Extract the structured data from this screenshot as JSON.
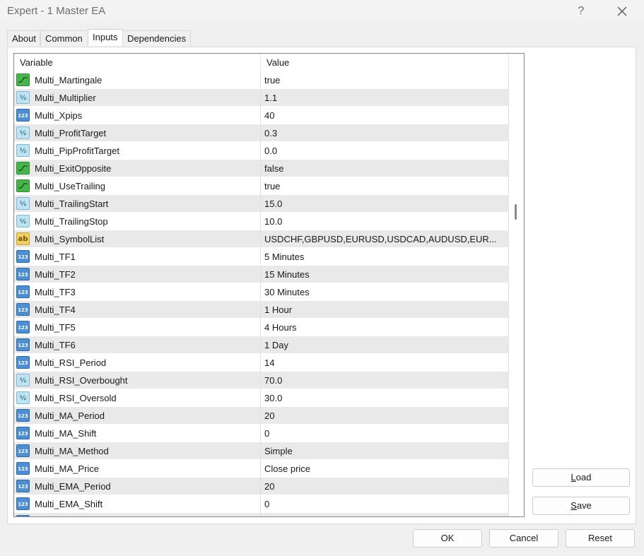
{
  "window": {
    "title": "Expert - 1 Master EA",
    "help_label": "?",
    "close_icon": "close-icon"
  },
  "tabs": [
    {
      "label": "About",
      "active": false
    },
    {
      "label": "Common",
      "active": false
    },
    {
      "label": "Inputs",
      "active": true
    },
    {
      "label": "Dependencies",
      "active": false
    }
  ],
  "grid": {
    "headers": {
      "variable": "Variable",
      "value": "Value"
    },
    "rows": [
      {
        "type": "bool",
        "name": "Multi_Martingale",
        "value": "true"
      },
      {
        "type": "double",
        "name": "Multi_Multiplier",
        "value": "1.1"
      },
      {
        "type": "int",
        "name": "Multi_Xpips",
        "value": "40"
      },
      {
        "type": "double",
        "name": "Multi_ProfitTarget",
        "value": "0.3"
      },
      {
        "type": "double",
        "name": "Multi_PipProfitTarget",
        "value": "0.0"
      },
      {
        "type": "bool",
        "name": "Multi_ExitOpposite",
        "value": "false"
      },
      {
        "type": "bool",
        "name": "Multi_UseTrailing",
        "value": "true"
      },
      {
        "type": "double",
        "name": "Multi_TrailingStart",
        "value": "15.0"
      },
      {
        "type": "double",
        "name": "Multi_TrailingStop",
        "value": "10.0"
      },
      {
        "type": "string",
        "name": "Multi_SymbolList",
        "value": "USDCHF,GBPUSD,EURUSD,USDCAD,AUDUSD,EUR..."
      },
      {
        "type": "int",
        "name": "Multi_TF1",
        "value": "5 Minutes"
      },
      {
        "type": "int",
        "name": "Multi_TF2",
        "value": "15 Minutes"
      },
      {
        "type": "int",
        "name": "Multi_TF3",
        "value": "30 Minutes"
      },
      {
        "type": "int",
        "name": "Multi_TF4",
        "value": "1 Hour"
      },
      {
        "type": "int",
        "name": "Multi_TF5",
        "value": "4 Hours"
      },
      {
        "type": "int",
        "name": "Multi_TF6",
        "value": "1 Day"
      },
      {
        "type": "int",
        "name": "Multi_RSI_Period",
        "value": "14"
      },
      {
        "type": "double",
        "name": "Multi_RSI_Overbought",
        "value": "70.0"
      },
      {
        "type": "double",
        "name": "Multi_RSI_Oversold",
        "value": "30.0"
      },
      {
        "type": "int",
        "name": "Multi_MA_Period",
        "value": "20"
      },
      {
        "type": "int",
        "name": "Multi_MA_Shift",
        "value": "0"
      },
      {
        "type": "int",
        "name": "Multi_MA_Method",
        "value": "Simple"
      },
      {
        "type": "int",
        "name": "Multi_MA_Price",
        "value": "Close price"
      },
      {
        "type": "int",
        "name": "Multi_EMA_Period",
        "value": "20"
      },
      {
        "type": "int",
        "name": "Multi_EMA_Shift",
        "value": "0"
      },
      {
        "type": "int",
        "name": "",
        "value": ""
      }
    ]
  },
  "side_buttons": {
    "load": {
      "prefix": "",
      "underlined": "L",
      "suffix": "oad"
    },
    "save": {
      "prefix": "",
      "underlined": "S",
      "suffix": "ave"
    }
  },
  "footer_buttons": {
    "ok": "OK",
    "cancel": "Cancel",
    "reset": "Reset"
  },
  "icons": {
    "bool": {
      "name": "bool-type-icon",
      "glyph": ""
    },
    "double": {
      "name": "double-type-icon",
      "glyph": "½"
    },
    "int": {
      "name": "integer-type-icon",
      "glyph": "123"
    },
    "string": {
      "name": "string-type-icon",
      "glyph": "ab"
    }
  },
  "colors": {
    "row_alt": "#e9e9e9",
    "bool_icon": "#47b54b",
    "int_icon": "#4d8fd1",
    "double_icon": "#bfe3f0",
    "string_icon": "#f1d063"
  }
}
